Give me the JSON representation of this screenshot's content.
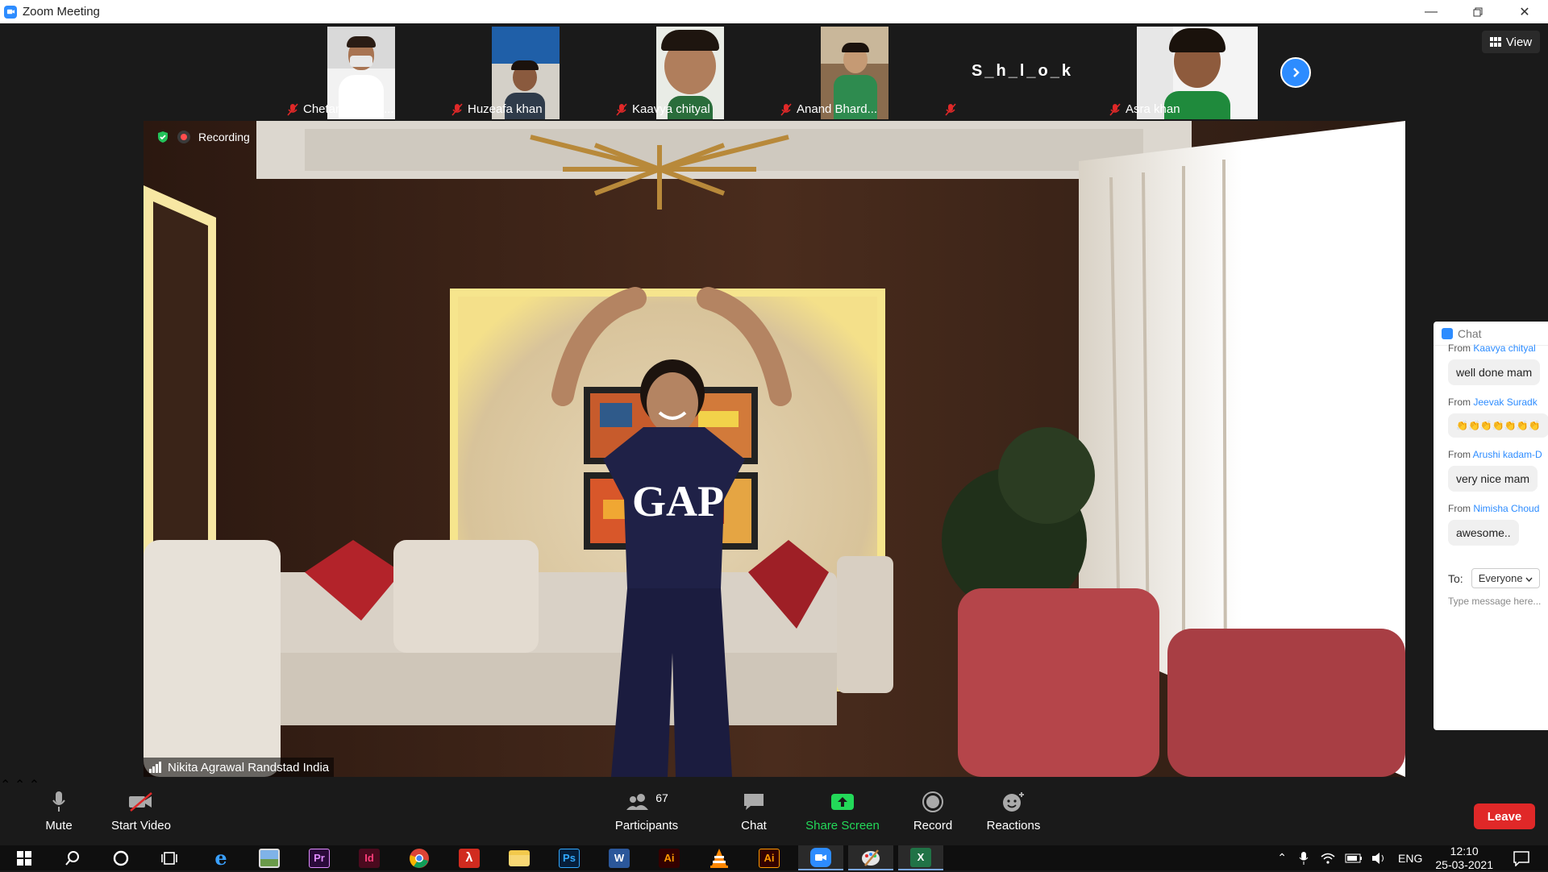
{
  "window": {
    "title": "Zoom Meeting"
  },
  "gallery": {
    "participants": [
      {
        "name": "Chetan J Rand..."
      },
      {
        "name": "Huzeafa khan"
      },
      {
        "name": "Kaavya chityal"
      },
      {
        "name": "Anand Bhard..."
      },
      {
        "name": "",
        "initials": "S_h_l_o_k"
      },
      {
        "name": "Asra khan"
      }
    ],
    "view_label": "View"
  },
  "video": {
    "recording_label": "Recording",
    "speaker_name": "Nikita Agrawal Randstad India"
  },
  "chat": {
    "title": "Chat",
    "messages": [
      {
        "from_prefix": "From",
        "from": "Kaavya chityal",
        "text": "well done mam"
      },
      {
        "from_prefix": "From",
        "from": "Jeevak  Suradk",
        "text": "👏👏👏👏👏👏👏"
      },
      {
        "from_prefix": "From",
        "from": "Arushi kadam-D",
        "text": "very nice mam"
      },
      {
        "from_prefix": "From",
        "from": "Nimisha Choud",
        "text": "awesome.."
      }
    ],
    "to_label": "To:",
    "to_value": "Everyone",
    "input_placeholder": "Type message here..."
  },
  "toolbar": {
    "mute": "Mute",
    "start_video": "Start Video",
    "participants": "Participants",
    "participants_count": "67",
    "chat": "Chat",
    "share_screen": "Share Screen",
    "record": "Record",
    "reactions": "Reactions",
    "leave": "Leave"
  },
  "taskbar": {
    "apps": [
      "Edge",
      "Photos",
      "Premiere Pro",
      "InDesign",
      "Chrome",
      "Acrobat",
      "File Explorer",
      "Photoshop",
      "Word",
      "Illustrator",
      "VLC",
      "Illustrator",
      "Zoom",
      "Paint",
      "Excel"
    ],
    "app_text": {
      "pr": "Pr",
      "id": "Id",
      "ps": "Ps",
      "w": "W",
      "ai1": "Ai",
      "ai2": "Ai",
      "x": "X"
    },
    "language": "ENG",
    "time": "12:10",
    "date": "25-03-2021"
  },
  "colors": {
    "accent": "#2d8cff",
    "leave": "#e02828",
    "share": "#23d959"
  }
}
